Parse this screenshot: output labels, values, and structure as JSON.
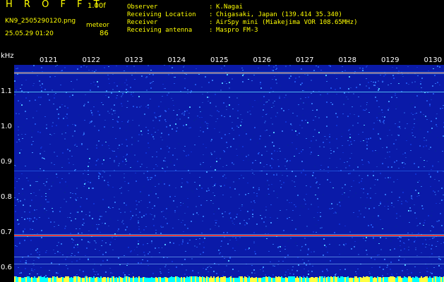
{
  "header": {
    "app_title": "H R O F F T",
    "version": "1.00f",
    "filename": "KN9_2505290120.png",
    "meteor_label": "meteor",
    "datetime": "25.05.29 01:20",
    "meteor_count": "86"
  },
  "meta": [
    {
      "key": "Observer",
      "value": "K.Nagai"
    },
    {
      "key": "Receiving Location",
      "value": "Chigasaki, Japan (139.414 35.340)"
    },
    {
      "key": "Receiver",
      "value": "AirSpy mini (Miakejima VOR 108.65MHz)"
    },
    {
      "key": "Receiving antenna",
      "value": "Maspro FM-3"
    }
  ],
  "axis": {
    "unit": "kHz",
    "time_labels": [
      "0121",
      "0122",
      "0123",
      "0124",
      "0125",
      "0126",
      "0127",
      "0128",
      "0129",
      "0130"
    ],
    "freq_labels": [
      "1.1",
      "1.0",
      "0.9",
      "0.8",
      "0.7",
      "0.6"
    ],
    "freq_values": [
      1.1,
      1.0,
      0.9,
      0.8,
      0.7,
      0.6
    ]
  },
  "colors": {
    "text": "#ffff00",
    "axis": "#ffffff",
    "background": "#0a1aa8",
    "signal": "#ff3030",
    "baseline": "#00ffff"
  }
}
